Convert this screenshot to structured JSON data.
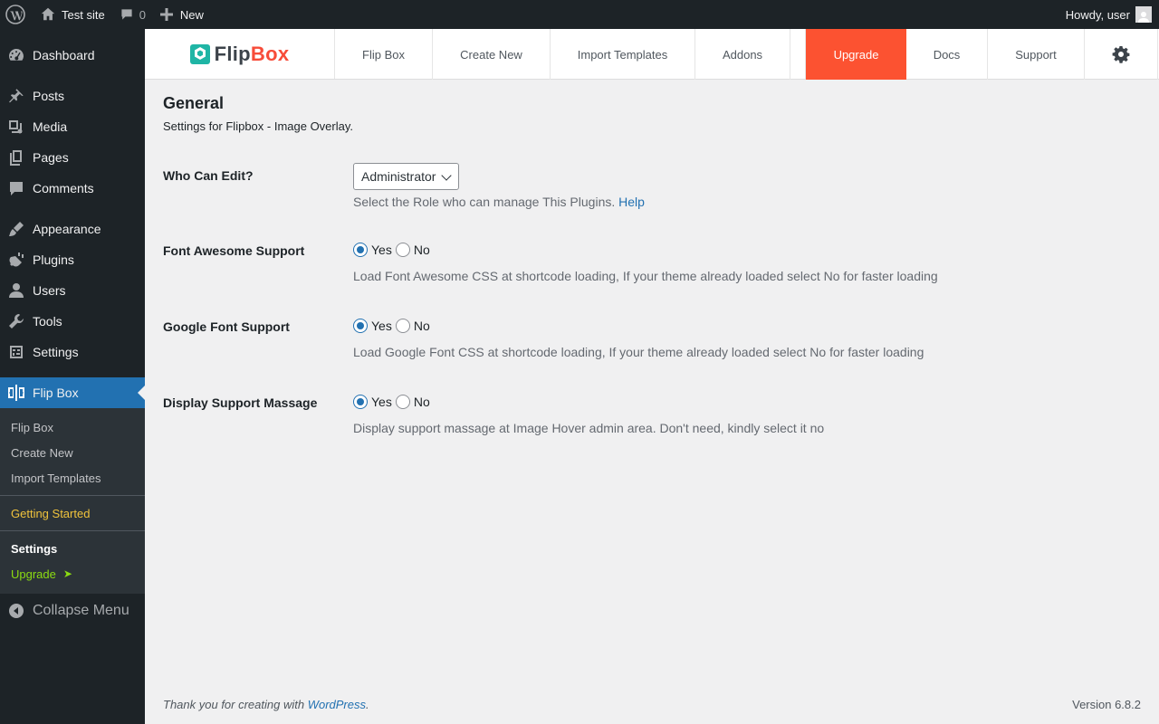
{
  "admin_bar": {
    "site_name": "Test site",
    "comments_count": "0",
    "new_label": "New",
    "howdy": "Howdy, user"
  },
  "sidebar": {
    "items": [
      {
        "label": "Dashboard",
        "icon": "dashboard-icon"
      },
      {
        "label": "Posts",
        "icon": "pin-icon"
      },
      {
        "label": "Media",
        "icon": "media-icon"
      },
      {
        "label": "Pages",
        "icon": "pages-icon"
      },
      {
        "label": "Comments",
        "icon": "comment-icon"
      },
      {
        "label": "Appearance",
        "icon": "brush-icon"
      },
      {
        "label": "Plugins",
        "icon": "plugin-icon"
      },
      {
        "label": "Users",
        "icon": "user-icon"
      },
      {
        "label": "Tools",
        "icon": "wrench-icon"
      },
      {
        "label": "Settings",
        "icon": "sliders-icon"
      },
      {
        "label": "Flip Box",
        "icon": "flipbox-icon"
      }
    ],
    "submenu": {
      "flip_box": "Flip Box",
      "create_new": "Create New",
      "import_templates": "Import Templates",
      "getting_started": "Getting Started",
      "settings": "Settings",
      "upgrade": "Upgrade",
      "upgrade_arrow": "➤"
    },
    "collapse": "Collapse Menu"
  },
  "header": {
    "logo_flip": "Flip",
    "logo_box": "Box",
    "tabs": [
      {
        "label": "Flip Box"
      },
      {
        "label": "Create New"
      },
      {
        "label": "Import Templates"
      },
      {
        "label": "Addons"
      },
      {
        "label": "Upgrade"
      },
      {
        "label": "Docs"
      },
      {
        "label": "Support"
      }
    ]
  },
  "page": {
    "title": "General",
    "description": "Settings for Flipbox - Image Overlay."
  },
  "settings": {
    "who_can_edit": {
      "label": "Who Can Edit?",
      "value": "Administrator",
      "help_text": "Select the Role who can manage This Plugins.",
      "help_link": "Help"
    },
    "font_awesome": {
      "label": "Font Awesome Support",
      "yes": "Yes",
      "no": "No",
      "selected": "Yes",
      "description": "Load Font Awesome CSS at shortcode loading, If your theme already loaded select No for faster loading"
    },
    "google_font": {
      "label": "Google Font Support",
      "yes": "Yes",
      "no": "No",
      "selected": "Yes",
      "description": "Load Google Font CSS at shortcode loading, If your theme already loaded select No for faster loading"
    },
    "support_massage": {
      "label": "Display Support Massage",
      "yes": "Yes",
      "no": "No",
      "selected": "Yes",
      "description": "Display support massage at Image Hover admin area. Don't need, kindly select it no"
    }
  },
  "footer": {
    "thanks": "Thank you for creating with",
    "wp_link": "WordPress",
    "period": ".",
    "version": "Version 6.8.2"
  },
  "colors": {
    "admin_bg": "#1d2327",
    "accent": "#2271b1",
    "upgrade_tab": "#fc5231",
    "logo_box": "#f74c39",
    "logo_icon": "#1fb5a5",
    "upgrade_text": "#8cdb12",
    "getting_started": "#f0c33c"
  }
}
